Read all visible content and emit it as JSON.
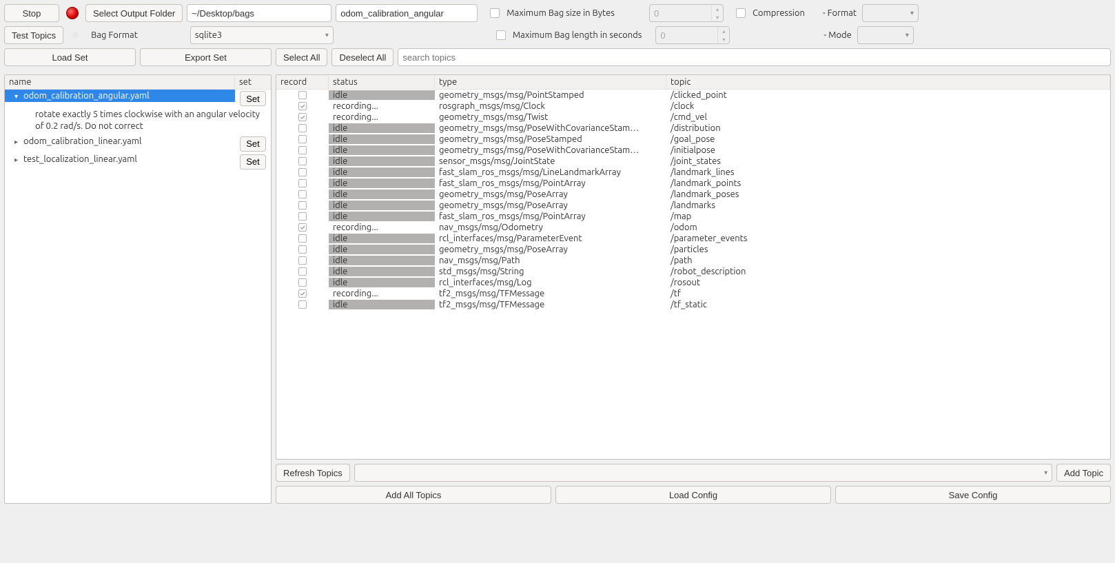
{
  "toolbar": {
    "stop": "Stop",
    "select_output_folder": "Select Output Folder",
    "output_path": "~/Desktop/bags",
    "bag_name": "odom_calibration_angular",
    "max_bag_size_label": "Maximum Bag size in Bytes",
    "max_bag_size_value": "0",
    "compression_label": "Compression",
    "format_label": "- Format",
    "test_topics": "Test Topics",
    "bag_format_label": "Bag Format",
    "bag_format_value": "sqlite3",
    "max_bag_len_label": "Maximum Bag length in seconds",
    "max_bag_len_value": "0",
    "mode_label": "- Mode"
  },
  "setbar": {
    "load_set": "Load Set",
    "export_set": "Export Set"
  },
  "topicbar": {
    "select_all": "Select All",
    "deselect_all": "Deselect All",
    "search_placeholder": "search topics"
  },
  "tree": {
    "headers": {
      "name": "name",
      "set": "set"
    },
    "set_btn": "Set",
    "items": [
      {
        "label": "odom_calibration_angular.yaml",
        "expanded": true,
        "selected": true,
        "desc": "rotate exactly 5 times clockwise with an angular velocity of 0.2 rad/s. Do not correct"
      },
      {
        "label": "odom_calibration_linear.yaml",
        "expanded": false,
        "selected": false,
        "desc": ""
      },
      {
        "label": "test_localization_linear.yaml",
        "expanded": false,
        "selected": false,
        "desc": ""
      }
    ]
  },
  "table": {
    "headers": {
      "record": "record",
      "status": "status",
      "type": "type",
      "topic": "topic"
    },
    "rows": [
      {
        "checked": false,
        "status": "idle",
        "type": "geometry_msgs/msg/PointStamped",
        "topic": "/clicked_point"
      },
      {
        "checked": true,
        "status": "recording...",
        "type": "rosgraph_msgs/msg/Clock",
        "topic": "/clock"
      },
      {
        "checked": true,
        "status": "recording...",
        "type": "geometry_msgs/msg/Twist",
        "topic": "/cmd_vel"
      },
      {
        "checked": false,
        "status": "idle",
        "type": "geometry_msgs/msg/PoseWithCovarianceStam…",
        "topic": "/distribution"
      },
      {
        "checked": false,
        "status": "idle",
        "type": "geometry_msgs/msg/PoseStamped",
        "topic": "/goal_pose"
      },
      {
        "checked": false,
        "status": "idle",
        "type": "geometry_msgs/msg/PoseWithCovarianceStam…",
        "topic": "/initialpose"
      },
      {
        "checked": false,
        "status": "idle",
        "type": "sensor_msgs/msg/JointState",
        "topic": "/joint_states"
      },
      {
        "checked": false,
        "status": "idle",
        "type": "fast_slam_ros_msgs/msg/LineLandmarkArray",
        "topic": "/landmark_lines"
      },
      {
        "checked": false,
        "status": "idle",
        "type": "fast_slam_ros_msgs/msg/PointArray",
        "topic": "/landmark_points"
      },
      {
        "checked": false,
        "status": "idle",
        "type": "geometry_msgs/msg/PoseArray",
        "topic": "/landmark_poses"
      },
      {
        "checked": false,
        "status": "idle",
        "type": "geometry_msgs/msg/PoseArray",
        "topic": "/landmarks"
      },
      {
        "checked": false,
        "status": "idle",
        "type": "fast_slam_ros_msgs/msg/PointArray",
        "topic": "/map"
      },
      {
        "checked": true,
        "status": "recording...",
        "type": "nav_msgs/msg/Odometry",
        "topic": "/odom"
      },
      {
        "checked": false,
        "status": "idle",
        "type": "rcl_interfaces/msg/ParameterEvent",
        "topic": "/parameter_events"
      },
      {
        "checked": false,
        "status": "idle",
        "type": "geometry_msgs/msg/PoseArray",
        "topic": "/particles"
      },
      {
        "checked": false,
        "status": "idle",
        "type": "nav_msgs/msg/Path",
        "topic": "/path"
      },
      {
        "checked": false,
        "status": "idle",
        "type": "std_msgs/msg/String",
        "topic": "/robot_description"
      },
      {
        "checked": false,
        "status": "idle",
        "type": "rcl_interfaces/msg/Log",
        "topic": "/rosout"
      },
      {
        "checked": true,
        "status": "recording...",
        "type": "tf2_msgs/msg/TFMessage",
        "topic": "/tf"
      },
      {
        "checked": false,
        "status": "idle",
        "type": "tf2_msgs/msg/TFMessage",
        "topic": "/tf_static"
      }
    ]
  },
  "bottom": {
    "refresh_topics": "Refresh Topics",
    "add_topic": "Add Topic",
    "add_all_topics": "Add All Topics",
    "load_config": "Load Config",
    "save_config": "Save Config"
  }
}
